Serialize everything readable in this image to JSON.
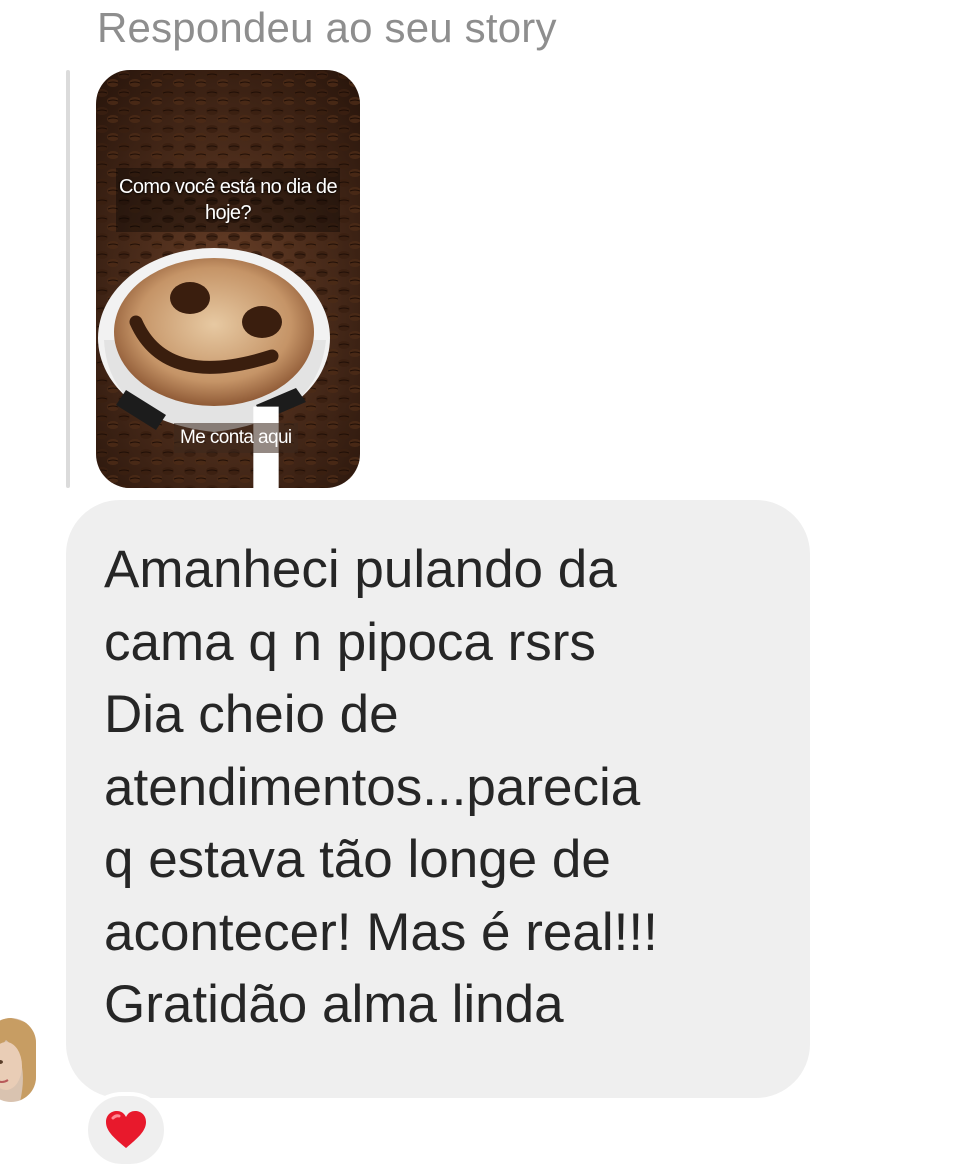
{
  "reply_header": "Respondeu ao seu story",
  "story": {
    "question": "Como você está no dia de hoje?",
    "cta": "Me conta aqui",
    "image": "coffee-cup-with-smiley-face-on-coffee-beans"
  },
  "message": {
    "text": "Amanheci pulando da\ncama q n pipoca rsrs\nDia cheio de\natendimentos...parecia\nq estava tão longe de\nacontecer! Mas é real!!!\nGratidão alma linda"
  },
  "reaction": {
    "emoji": "❤️",
    "icon": "red-heart-icon",
    "color": "#e8192c"
  },
  "colors": {
    "bubble": "#efefef",
    "text": "#262626",
    "muted": "#8e8e8e"
  }
}
